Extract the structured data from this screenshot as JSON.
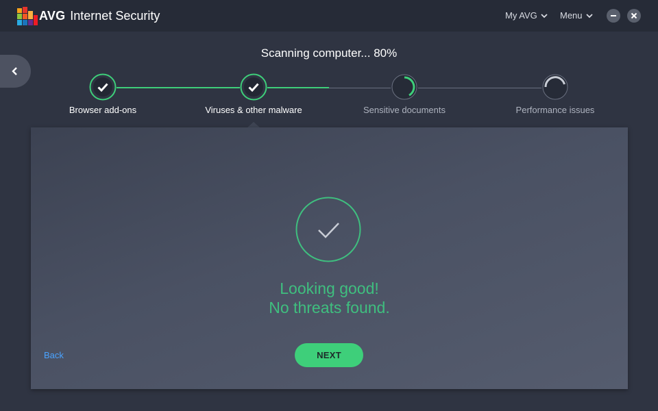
{
  "app": {
    "brand": "AVG",
    "product": "Internet Security"
  },
  "header": {
    "my_avg_label": "My AVG",
    "menu_label": "Menu"
  },
  "scan": {
    "title": "Scanning computer... 80%",
    "progress_percent": 80
  },
  "steps": [
    {
      "label": "Browser add-ons",
      "status": "done"
    },
    {
      "label": "Viruses & other malware",
      "status": "done"
    },
    {
      "label": "Sensitive documents",
      "status": "in-progress"
    },
    {
      "label": "Performance issues",
      "status": "in-progress"
    }
  ],
  "result": {
    "line1": "Looking good!",
    "line2": "No threats found."
  },
  "actions": {
    "back_label": "Back",
    "next_label": "NEXT"
  },
  "colors": {
    "accent_green": "#3ecf7a",
    "result_green": "#3fbf7f",
    "link_blue": "#4aa3ff",
    "background": "#2f3442",
    "titlebar": "#262b37"
  }
}
